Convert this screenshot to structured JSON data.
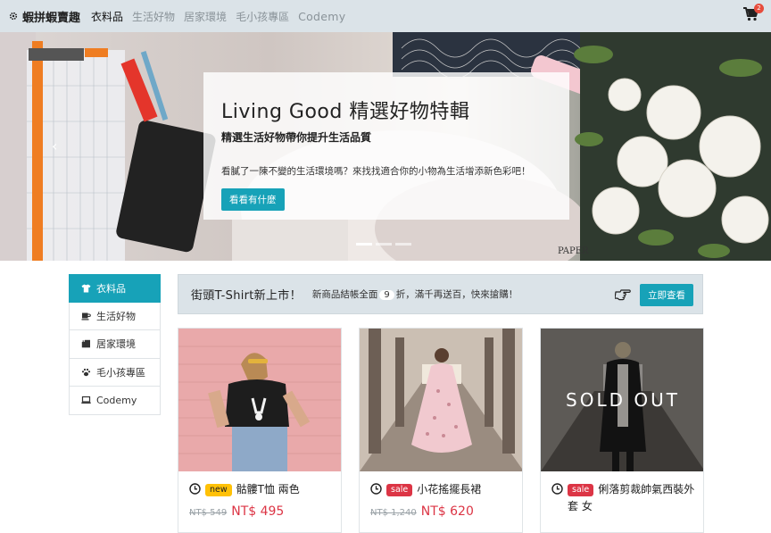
{
  "navbar": {
    "brand": "蝦拼蝦賣趣",
    "items": [
      {
        "label": "衣料品",
        "active": true
      },
      {
        "label": "生活好物",
        "active": false
      },
      {
        "label": "居家環境",
        "active": false
      },
      {
        "label": "毛小孩專區",
        "active": false
      },
      {
        "label": "Codemy",
        "active": false
      }
    ],
    "cart_count": "2"
  },
  "hero": {
    "title": "Living Good 精選好物特輯",
    "subtitle": "精選生活好物帶你提升生活品質",
    "description": "看膩了一陳不變的生活環境嗎？來找找適合你的小物為生活增添新色彩吧！",
    "button": "看看有什麼",
    "prev_glyph": "‹",
    "indicators": [
      true,
      false,
      false
    ]
  },
  "sidebar": {
    "items": [
      {
        "label": "衣料品",
        "icon": "shirt-icon",
        "active": true
      },
      {
        "label": "生活好物",
        "icon": "coffee-icon",
        "active": false
      },
      {
        "label": "居家環境",
        "icon": "couch-icon",
        "active": false
      },
      {
        "label": "毛小孩專區",
        "icon": "paw-icon",
        "active": false
      },
      {
        "label": "Codemy",
        "icon": "laptop-icon",
        "active": false
      }
    ]
  },
  "promo": {
    "title": "街頭T-Shirt新上市！",
    "text_before": "新商品結帳全面",
    "badge": "9",
    "text_after": "折，滿千再送百，快來搶購！",
    "button": "立即查看",
    "hand_icon": "pointing-hand-icon"
  },
  "products": [
    {
      "tag": "new",
      "name": "骷髏T恤 兩色",
      "old_price": "NT$ 549",
      "price": "NT$ 495",
      "sold_out": false
    },
    {
      "tag": "sale",
      "name": "小花搖擺長裙",
      "old_price": "NT$ 1,240",
      "price": "NT$ 620",
      "sold_out": false
    },
    {
      "tag": "sale",
      "name": "俐落剪裁帥氣西裝外套 女",
      "old_price": "",
      "price": "",
      "sold_out": true,
      "sold_out_label": "SOLD OUT"
    }
  ],
  "colors": {
    "accent": "#17a2b8",
    "navbar": "#dbe3e8",
    "sale": "#dc3545",
    "new": "#ffc107"
  }
}
